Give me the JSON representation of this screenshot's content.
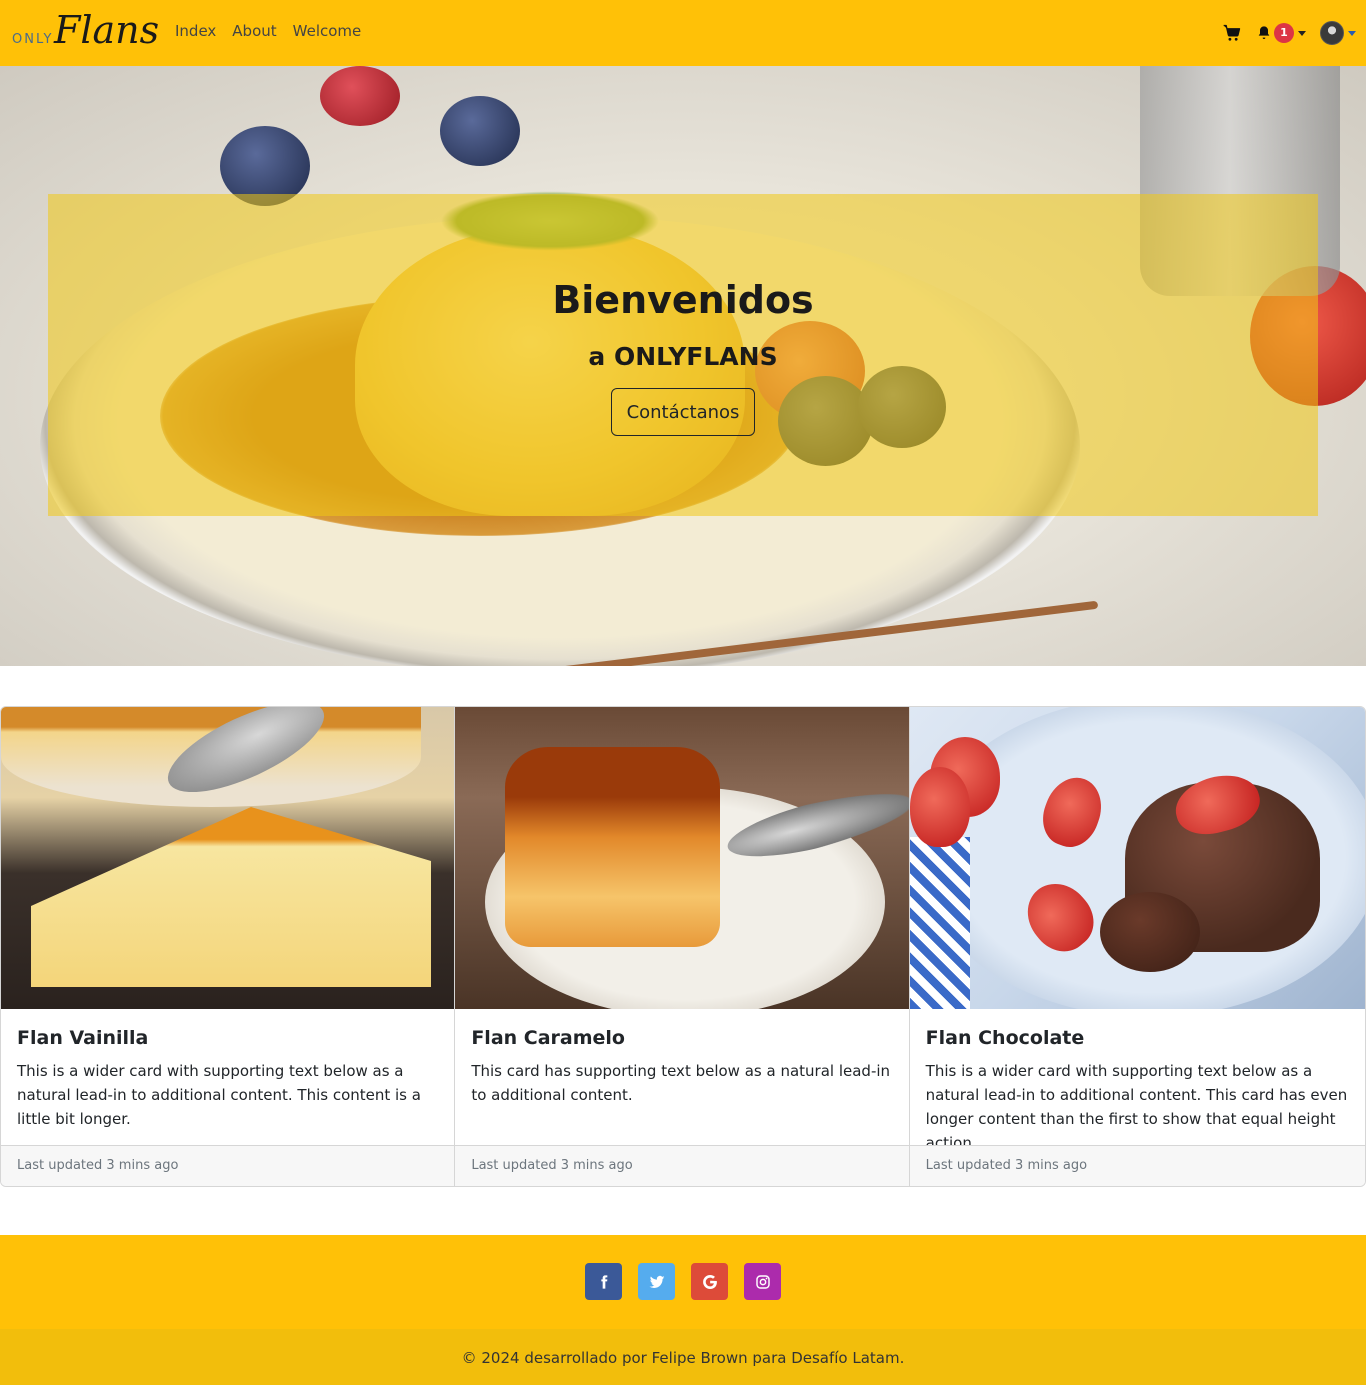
{
  "navbar": {
    "brand_prefix": "ONLY",
    "brand_name": "Flans",
    "links": [
      "Index",
      "About",
      "Welcome"
    ],
    "notification_count": "1",
    "icons": {
      "cart": "shopping-cart-icon",
      "bell": "bell-icon",
      "avatar": "user-avatar"
    }
  },
  "hero": {
    "title": "Bienvenidos",
    "subtitle": "a ONLYFLANS",
    "button_label": "Contáctanos"
  },
  "cards": [
    {
      "title": "Flan Vainilla",
      "text": "This is a wider card with supporting text below as a natural lead-in to additional content. This content is a little bit longer.",
      "footer": "Last updated 3 mins ago"
    },
    {
      "title": "Flan Caramelo",
      "text": "This card has supporting text below as a natural lead-in to additional content.",
      "footer": "Last updated 3 mins ago"
    },
    {
      "title": "Flan Chocolate",
      "text": "This is a wider card with supporting text below as a natural lead-in to additional content. This card has even longer content than the first to show that equal height action.",
      "footer": "Last updated 3 mins ago"
    }
  ],
  "footer": {
    "social": [
      {
        "name": "facebook",
        "icon": "facebook-icon",
        "color": "#3b5998"
      },
      {
        "name": "twitter",
        "icon": "twitter-icon",
        "color": "#55acee"
      },
      {
        "name": "google",
        "icon": "google-icon",
        "color": "#dd4b39"
      },
      {
        "name": "instagram",
        "icon": "instagram-icon",
        "color": "#ac2bac"
      }
    ],
    "copyright": "© 2024 desarrollado por Felipe Brown para Desafío Latam."
  },
  "colors": {
    "brand": "#ffc107",
    "footer_bottom": "#f2be0c",
    "badge": "#dc3545"
  }
}
